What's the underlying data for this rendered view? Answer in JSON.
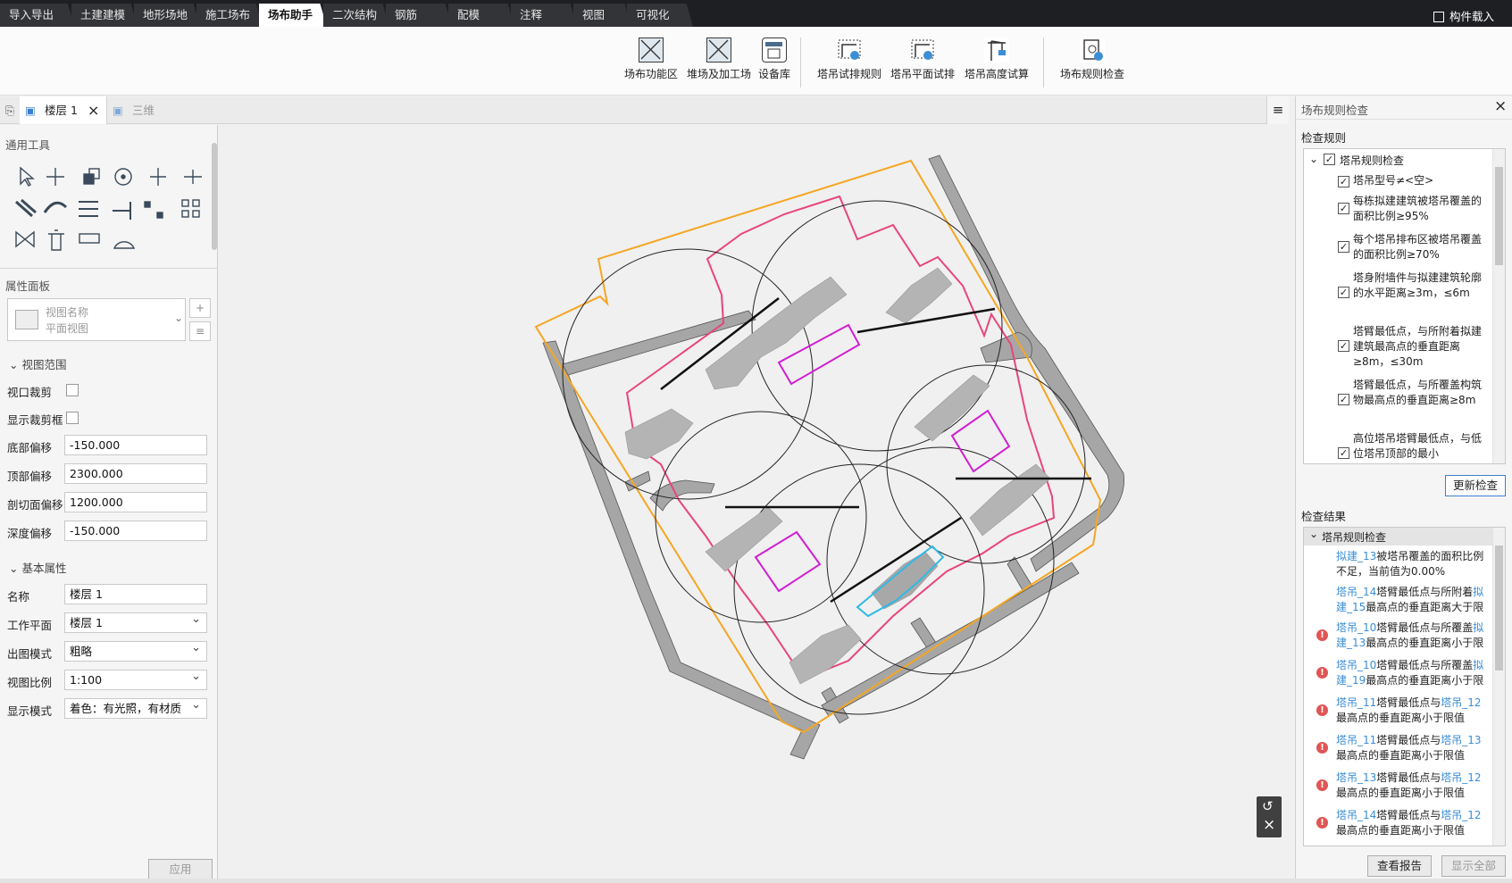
{
  "top_tabs": [
    {
      "label": "导入导出"
    },
    {
      "label": "土建建模"
    },
    {
      "label": "地形场地"
    },
    {
      "label": "施工场布"
    },
    {
      "label": "场布助手"
    },
    {
      "label": "二次结构"
    },
    {
      "label": "钢筋"
    },
    {
      "label": "配模"
    },
    {
      "label": "注释"
    },
    {
      "label": "视图"
    },
    {
      "label": "可视化"
    }
  ],
  "active_tab": "场布助手",
  "top_right": {
    "label": "构件载入"
  },
  "ribbon": {
    "buttons": [
      {
        "label": "场布功能区",
        "icon": "area-icon"
      },
      {
        "label": "堆场及加工场",
        "icon": "yard-icon"
      },
      {
        "label": "设备库",
        "icon": "device-library-icon"
      },
      {
        "label": "塔吊试排规则",
        "icon": "crane-rule-icon"
      },
      {
        "label": "塔吊平面试排",
        "icon": "crane-plan-icon"
      },
      {
        "label": "塔吊高度试算",
        "icon": "crane-height-icon"
      },
      {
        "label": "场布规则检查",
        "icon": "rule-check-icon"
      }
    ]
  },
  "view_tabs": [
    {
      "label": "楼层 1",
      "active": true
    },
    {
      "label": "三维",
      "active": false
    }
  ],
  "left_panel": {
    "tools_title": "通用工具",
    "props_title": "属性面板",
    "view_selector": {
      "line1": "视图名称",
      "line2": "平面视图"
    },
    "view_range": {
      "title": "视图范围",
      "rows": [
        {
          "label": "视口裁剪",
          "type": "checkbox"
        },
        {
          "label": "显示裁剪框",
          "type": "checkbox"
        },
        {
          "label": "底部偏移",
          "value": "-150.000"
        },
        {
          "label": "顶部偏移",
          "value": "2300.000"
        },
        {
          "label": "剖切面偏移",
          "value": "1200.000"
        },
        {
          "label": "深度偏移",
          "value": "-150.000"
        }
      ]
    },
    "basic_props": {
      "title": "基本属性",
      "rows": [
        {
          "label": "名称",
          "value": "楼层 1",
          "dropdown": false
        },
        {
          "label": "工作平面",
          "value": "楼层 1",
          "dropdown": true
        },
        {
          "label": "出图模式",
          "value": "粗略",
          "dropdown": true
        },
        {
          "label": "视图比例",
          "value": "1:100",
          "dropdown": true
        },
        {
          "label": "显示模式",
          "value": "着色：有光照，有材质",
          "dropdown": true
        }
      ]
    },
    "apply_label": "应用"
  },
  "right_panel": {
    "title": "场布规则检查",
    "rules_title": "检查规则",
    "rule_root": "塔吊规则检查",
    "rules": [
      "塔吊型号≠<空>",
      "每栋拟建建筑被塔吊覆盖的面积比例≥95%",
      "每个塔吊排布区被塔吊覆盖的面积比例≥70%",
      "塔身附墙件与拟建建筑轮廓的水平距离≥3m，≤6m",
      "塔臂最低点，与所附着拟建建筑最高点的垂直距离≥8m，≤30m",
      "塔臂最低点，与所覆盖构筑物最高点的垂直距离≥8m",
      "高位塔吊塔臂最低点，与低位塔吊顶部的最小"
    ],
    "update_label": "更新检查",
    "results_title": "检查结果",
    "result_root": "塔吊规则检查",
    "results": [
      {
        "parts": [
          {
            "t": "拟建_13",
            "link": true
          },
          {
            "t": "被塔吊覆盖的面积比例不足，当前值为0.00%",
            "link": false
          }
        ],
        "warn": false
      },
      {
        "parts": [
          {
            "t": "塔吊_14",
            "link": true
          },
          {
            "t": "塔臂最低点与所附着",
            "link": false
          },
          {
            "t": "拟建_15",
            "link": true
          },
          {
            "t": "最高点的垂直距离大于限",
            "link": false
          }
        ],
        "warn": false
      },
      {
        "parts": [
          {
            "t": "塔吊_10",
            "link": true
          },
          {
            "t": "塔臂最低点与所覆盖",
            "link": false
          },
          {
            "t": "拟建_13",
            "link": true
          },
          {
            "t": "最高点的垂直距离小于限",
            "link": false
          }
        ],
        "warn": true
      },
      {
        "parts": [
          {
            "t": "塔吊_10",
            "link": true
          },
          {
            "t": "塔臂最低点与所覆盖",
            "link": false
          },
          {
            "t": "拟建_19",
            "link": true
          },
          {
            "t": "最高点的垂直距离小于限",
            "link": false
          }
        ],
        "warn": true
      },
      {
        "parts": [
          {
            "t": "塔吊_11",
            "link": true
          },
          {
            "t": "塔臂最低点与",
            "link": false
          },
          {
            "t": "塔吊_12",
            "link": true
          },
          {
            "t": "最高点的垂直距离小于限值",
            "link": false
          }
        ],
        "warn": true
      },
      {
        "parts": [
          {
            "t": "塔吊_11",
            "link": true
          },
          {
            "t": "塔臂最低点与",
            "link": false
          },
          {
            "t": "塔吊_13",
            "link": true
          },
          {
            "t": "最高点的垂直距离小于限值",
            "link": false
          }
        ],
        "warn": true
      },
      {
        "parts": [
          {
            "t": "塔吊_13",
            "link": true
          },
          {
            "t": "塔臂最低点与",
            "link": false
          },
          {
            "t": "塔吊_12",
            "link": true
          },
          {
            "t": "最高点的垂直距离小于限值",
            "link": false
          }
        ],
        "warn": true
      },
      {
        "parts": [
          {
            "t": "塔吊_14",
            "link": true
          },
          {
            "t": "塔臂最低点与",
            "link": false
          },
          {
            "t": "塔吊_12",
            "link": true
          },
          {
            "t": "最高点的垂直距离小于限值",
            "link": false
          }
        ],
        "warn": true
      }
    ],
    "report_label": "查看报告",
    "show_all_label": "显示全部"
  },
  "colors": {
    "boundary_orange": "#f5a623",
    "zone_pink": "#e8457a",
    "crane_zone_magenta": "#d11fd1",
    "selected_cyan": "#2fb9e6",
    "road_gray": "#a6a6a6",
    "building_gray": "#b4b4b4",
    "link_blue": "#3b8ed6"
  }
}
